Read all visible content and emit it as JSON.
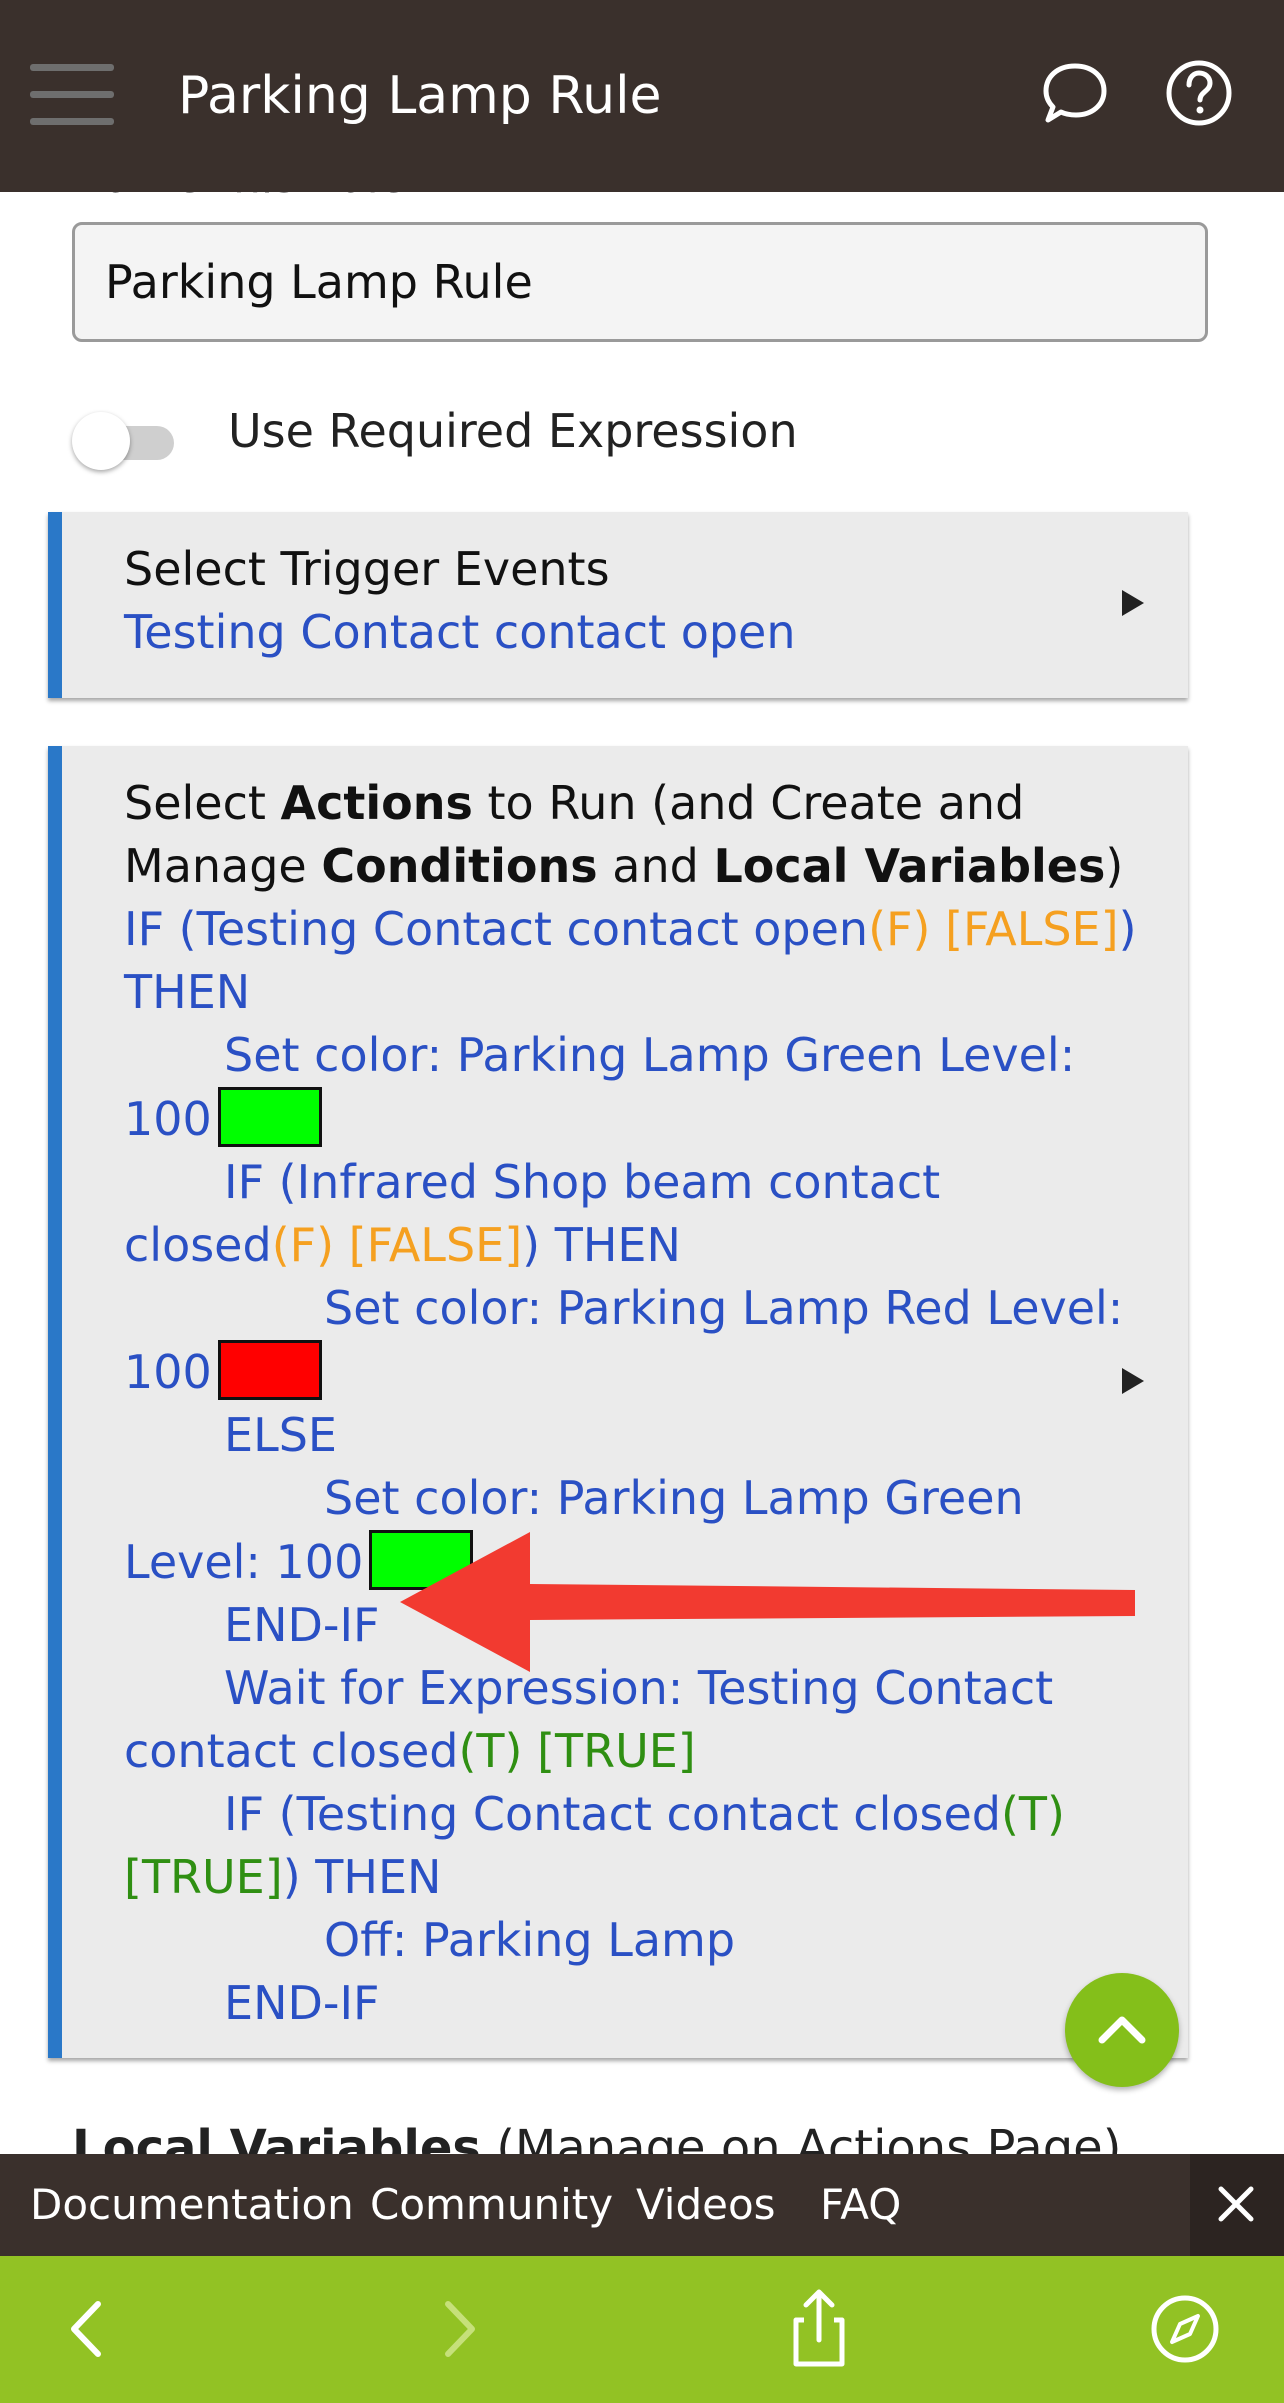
{
  "header": {
    "title": "Parking Lamp Rule"
  },
  "form": {
    "name_label": "Name this Rule",
    "name_value": "Parking Lamp Rule",
    "toggle_label": "Use Required Expression",
    "toggle_on": false
  },
  "trigger_card": {
    "title": "Select Trigger Events",
    "value": "Testing Contact contact open"
  },
  "actions_card": {
    "title_parts": [
      "Select ",
      "Actions",
      " to Run (and Create and",
      "Manage ",
      "Conditions",
      " and ",
      "Local Variables",
      ")"
    ],
    "lines": {
      "l1a": "IF (Testing Contact contact open",
      "l1b": "(F) [FALSE]",
      "l1c": ")",
      "l2": "THEN",
      "l3": "Set color: Parking Lamp   Green  Level:",
      "l4": "100",
      "l5": "IF (Infrared Shop beam contact",
      "l6a": "closed",
      "l6b": "(F) [FALSE]",
      "l6c": ") THEN",
      "l7": "Set color: Parking Lamp   Red  Level:",
      "l8": "100",
      "l9": "ELSE",
      "l10": "Set color: Parking Lamp   Green",
      "l11": "Level: 100",
      "l12": "END-IF",
      "l13": "Wait for Expression: Testing Contact",
      "l14a": "contact closed",
      "l14b": "(T) [TRUE]",
      "l15a": "IF (Testing Contact contact closed",
      "l15b": "(T)",
      "l16a": "[TRUE]",
      "l16b": ") THEN",
      "l17": "Off: Parking Lamp",
      "l18": "END-IF"
    },
    "swatch_colors": [
      "#00ff00",
      "#ff0000",
      "#00ff00"
    ]
  },
  "local_variables_peek": {
    "title": "Local Variables",
    "note": " (Manage on Actions Page)"
  },
  "link_bar": {
    "items": [
      "Documentation",
      "Community",
      "Videos",
      "FAQ"
    ]
  },
  "icons": {
    "menu": "hamburger-icon",
    "chat": "chat-bubble-icon",
    "help": "help-icon",
    "scroll_top": "chevron-up-icon",
    "close": "close-icon",
    "back": "back-icon",
    "forward": "forward-icon",
    "share": "share-icon",
    "compass": "compass-icon"
  },
  "colors": {
    "header_bg": "#3a302c",
    "accent_blue": "#2a78c8",
    "link_blue": "#2a50c4",
    "false_orange": "#f5a020",
    "true_green": "#2f8f12",
    "browser_bar": "#92c224",
    "fab": "#84bf1a",
    "annotation_arrow": "#f23a30"
  }
}
